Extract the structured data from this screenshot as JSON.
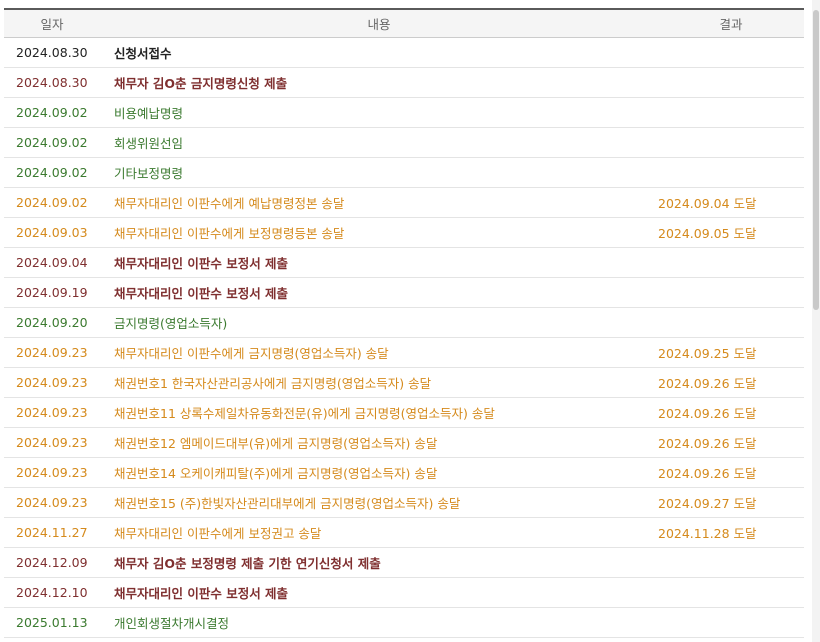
{
  "table": {
    "headers": {
      "date": "일자",
      "content": "내용",
      "result": "결과"
    },
    "rows": [
      {
        "date": "2024.08.30",
        "content": "신청서접수",
        "result": "",
        "kind": "black"
      },
      {
        "date": "2024.08.30",
        "content": "채무자 김O춘 금지명령신청 제출",
        "result": "",
        "kind": "red"
      },
      {
        "date": "2024.09.02",
        "content": "비용예납명령",
        "result": "",
        "kind": "green"
      },
      {
        "date": "2024.09.02",
        "content": "회생위원선임",
        "result": "",
        "kind": "green"
      },
      {
        "date": "2024.09.02",
        "content": "기타보정명령",
        "result": "",
        "kind": "green"
      },
      {
        "date": "2024.09.02",
        "content": "채무자대리인 이판수에게 예납명령정본 송달",
        "result": "2024.09.04 도달",
        "kind": "orange"
      },
      {
        "date": "2024.09.03",
        "content": "채무자대리인 이판수에게 보정명령등본 송달",
        "result": "2024.09.05 도달",
        "kind": "orange"
      },
      {
        "date": "2024.09.04",
        "content": "채무자대리인 이판수 보정서 제출",
        "result": "",
        "kind": "red"
      },
      {
        "date": "2024.09.19",
        "content": "채무자대리인 이판수 보정서 제출",
        "result": "",
        "kind": "red"
      },
      {
        "date": "2024.09.20",
        "content": "금지명령(영업소득자)",
        "result": "",
        "kind": "green"
      },
      {
        "date": "2024.09.23",
        "content": "채무자대리인 이판수에게 금지명령(영업소득자) 송달",
        "result": "2024.09.25 도달",
        "kind": "orange"
      },
      {
        "date": "2024.09.23",
        "content": "채권번호1 한국자산관리공사에게 금지명령(영업소득자) 송달",
        "result": "2024.09.26 도달",
        "kind": "orange"
      },
      {
        "date": "2024.09.23",
        "content": "채권번호11 상록수제일차유동화전문(유)에게 금지명령(영업소득자) 송달",
        "result": "2024.09.26 도달",
        "kind": "orange"
      },
      {
        "date": "2024.09.23",
        "content": "채권번호12 엠메이드대부(유)에게 금지명령(영업소득자) 송달",
        "result": "2024.09.26 도달",
        "kind": "orange"
      },
      {
        "date": "2024.09.23",
        "content": "채권번호14 오케이캐피탈(주)에게 금지명령(영업소득자) 송달",
        "result": "2024.09.26 도달",
        "kind": "orange"
      },
      {
        "date": "2024.09.23",
        "content": "채권번호15 (주)한빛자산관리대부에게 금지명령(영업소득자) 송달",
        "result": "2024.09.27 도달",
        "kind": "orange"
      },
      {
        "date": "2024.11.27",
        "content": "채무자대리인 이판수에게 보정권고 송달",
        "result": "2024.11.28 도달",
        "kind": "orange"
      },
      {
        "date": "2024.12.09",
        "content": "채무자 김O춘 보정명령 제출 기한 연기신청서 제출",
        "result": "",
        "kind": "red"
      },
      {
        "date": "2024.12.10",
        "content": "채무자대리인 이판수 보정서 제출",
        "result": "",
        "kind": "red"
      },
      {
        "date": "2025.01.13",
        "content": "개인회생절차개시결정",
        "result": "",
        "kind": "green"
      }
    ]
  },
  "colors": {
    "black": "#222222",
    "red": "#7f2f2f",
    "green": "#3b7a2f",
    "orange": "#d58a1c"
  }
}
